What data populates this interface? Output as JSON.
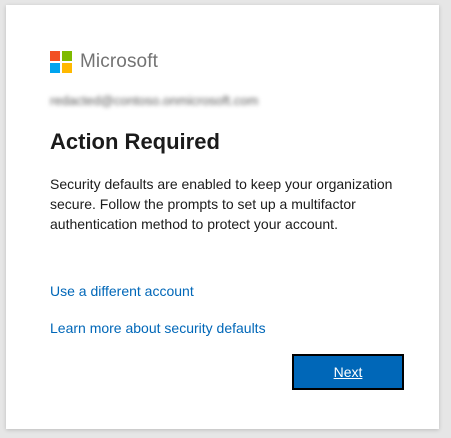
{
  "brand": {
    "name": "Microsoft",
    "logo_colors": [
      "#f25022",
      "#7fba00",
      "#00a4ef",
      "#ffb900"
    ]
  },
  "account": {
    "email": "redacted@contoso.onmicrosoft.com"
  },
  "page": {
    "title": "Action Required",
    "description": "Security defaults are enabled to keep your organization secure. Follow the prompts to set up a multifactor authentication method to protect your account."
  },
  "links": {
    "different_account": "Use a different account",
    "learn_more": "Learn more about security defaults"
  },
  "actions": {
    "next_label": "Next"
  },
  "colors": {
    "accent": "#0067b8",
    "background": "#e6e6e6",
    "card": "#ffffff"
  }
}
